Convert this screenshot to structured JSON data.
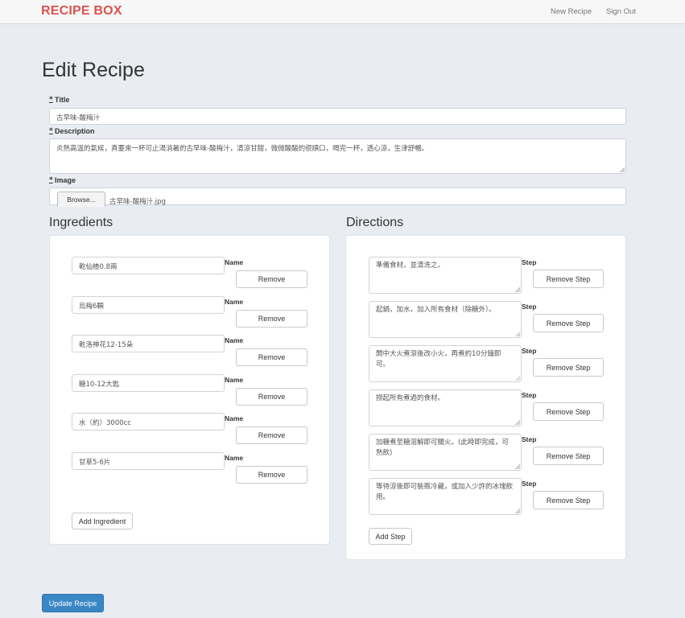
{
  "navbar": {
    "brand": "RECIPE BOX",
    "links": [
      "New Recipe",
      "Sign Out"
    ]
  },
  "page": {
    "title": "Edit Recipe"
  },
  "form": {
    "required_mark": "*",
    "title_label": "Title",
    "title_value": "古早味-酸梅汁",
    "description_label": "Description",
    "description_value": "炎熱高溫的氣候，真要來一杯可止渴消暑的古早味-酸梅汁，清涼甘甜，微微酸酸的很順口，喝完一杯，透心涼，生津舒暢。",
    "image_label": "Image",
    "browse_label": "Browse...",
    "image_filename": "古早味-酸梅汁.jpg"
  },
  "ingredients": {
    "title": "Ingredients",
    "name_label": "Name",
    "remove_label": "Remove",
    "items": [
      "乾仙楂0.8兩",
      "烏梅6顆",
      "乾洛神花12-15朵",
      "糖10-12大匙",
      "水（約）3000cc",
      "甘草5-6片"
    ],
    "add_label": "Add Ingredient"
  },
  "directions": {
    "title": "Directions",
    "step_label": "Step",
    "remove_label": "Remove Step",
    "steps": [
      "準備食材，並清洗之。",
      "起鍋，加水，加入所有食材（除糖外）。",
      "開中大火煮滾後改小火，再煮約10分鐘即可。",
      "撈起所有煮過的食材。",
      "加糖煮至糖溶解即可關火。(此時即完成，可熱飲)",
      "等待涼後即可裝瓶冷藏，或加入少許的冰塊飲用。"
    ],
    "add_label": "Add Step"
  },
  "submit_label": "Update Recipe",
  "colors": {
    "brand": "#d9534f",
    "primary": "#3a87c6",
    "background": "#e9ecf1"
  }
}
